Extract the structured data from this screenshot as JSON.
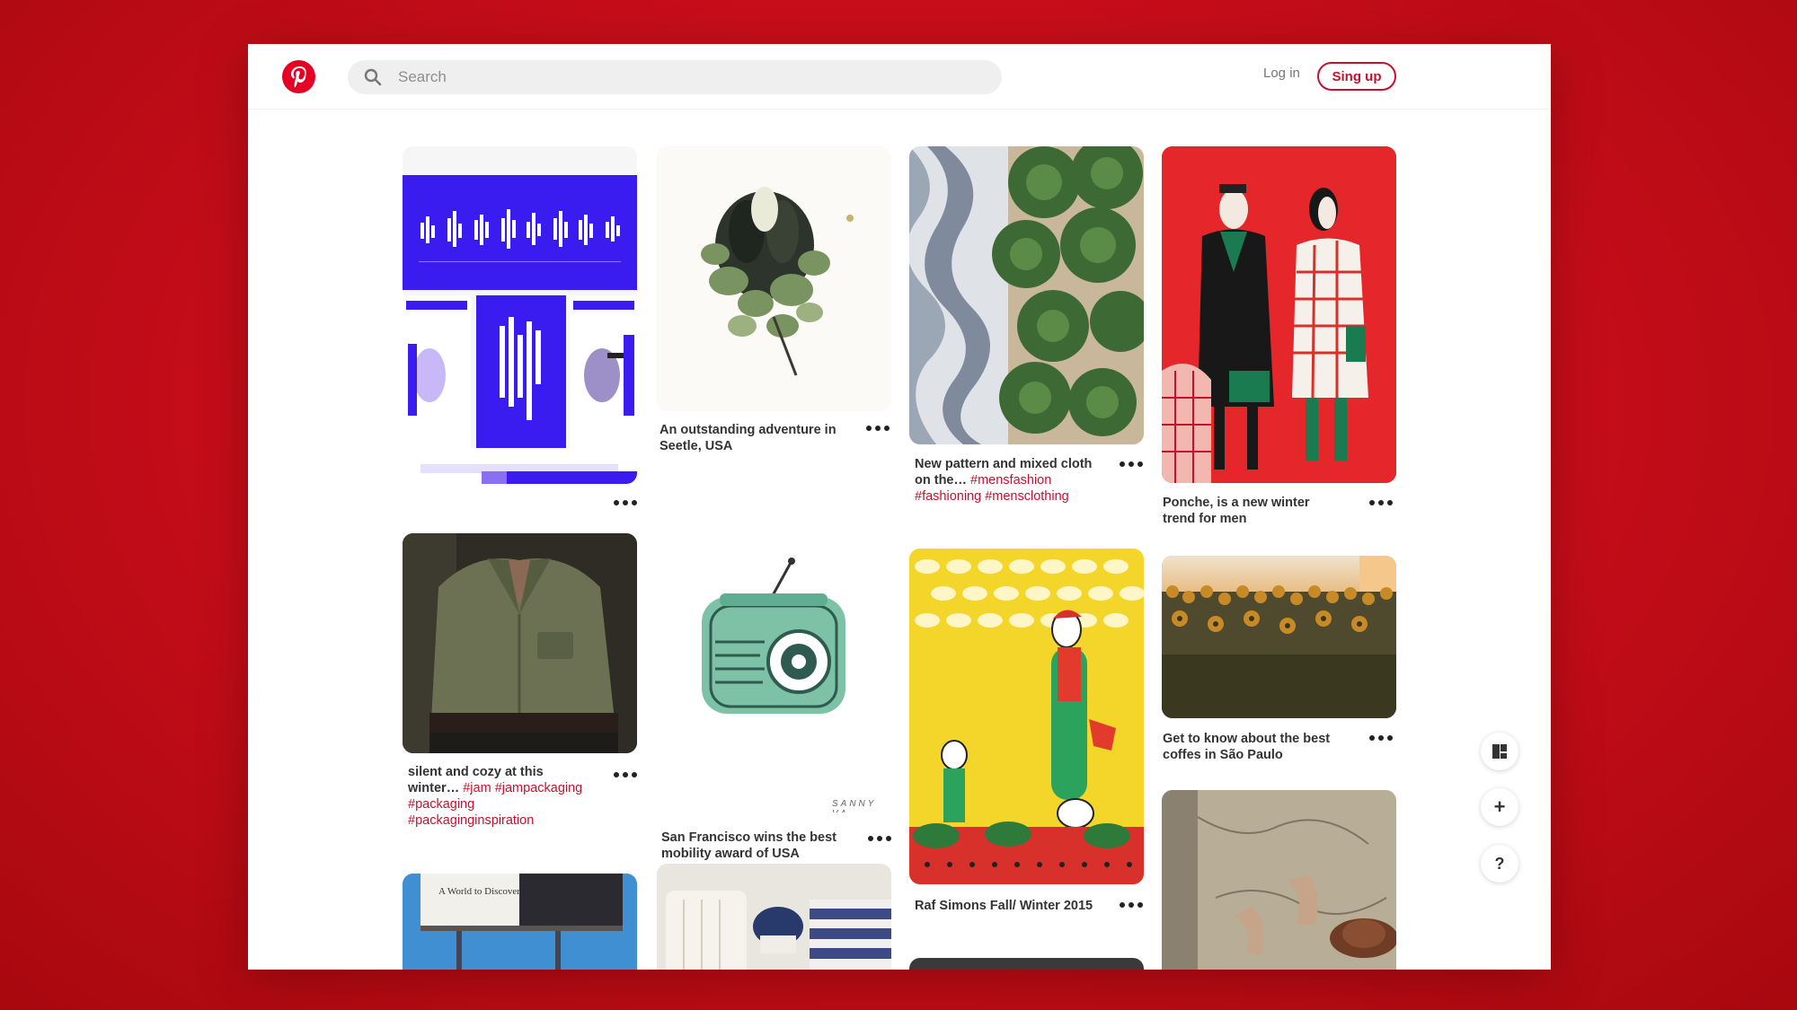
{
  "header": {
    "search_placeholder": "Search",
    "login_label": "Log in",
    "signup_label": "Sing up"
  },
  "pins": [
    {
      "title": "",
      "tags": ""
    },
    {
      "title": "An outstanding adventure in Seetle, USA",
      "tags": ""
    },
    {
      "title": "New pattern and mixed cloth on the…",
      "tags": "#mensfashion #fashioning #mensclothing"
    },
    {
      "title": "Ponche, is a new winter trend for men",
      "tags": ""
    },
    {
      "title": "silent and cozy at this winter…",
      "tags": "#jam #jampackaging #packaging #packaginginspiration"
    },
    {
      "title": "San Francisco wins the best mobility award of USA",
      "tags": ""
    },
    {
      "title": "Raf Simons Fall/ Winter 2015",
      "tags": ""
    },
    {
      "title": "Get to know about the best coffes in São Paulo",
      "tags": ""
    }
  ],
  "radio_watermark": "SANNY VA",
  "billboard_text": "A World to Discover",
  "side_buttons": {
    "add": "+",
    "help": "?"
  },
  "colors": {
    "brand": "#e60023",
    "link": "#c8102e"
  }
}
